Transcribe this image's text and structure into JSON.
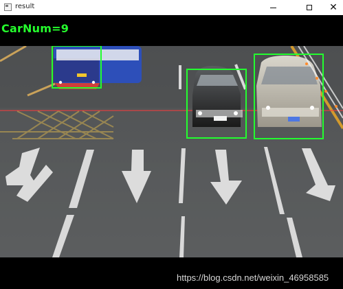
{
  "window": {
    "title": "result"
  },
  "controls": {
    "minimize_icon": "minimize-icon",
    "maximize_icon": "maximize-icon",
    "close_icon": "close-icon"
  },
  "overlay": {
    "car_count_text": "CarNum=9",
    "watermark": "https://blog.csdn.net/weixin_46958585"
  },
  "detections_color": "#23ff2f",
  "reference_line_color": "#ff3b3b"
}
